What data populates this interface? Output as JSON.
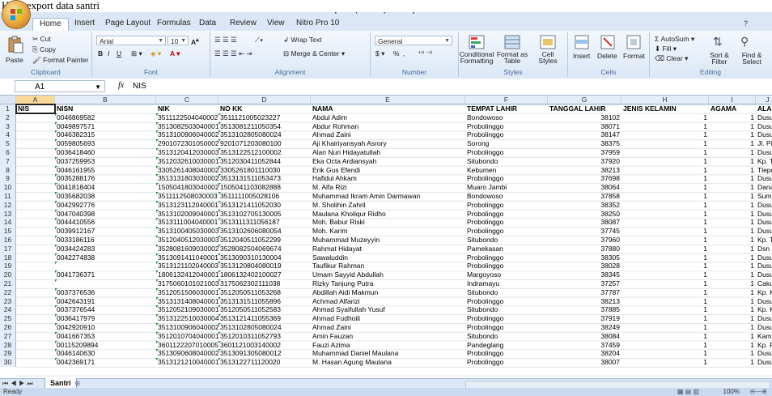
{
  "caption": "Hasil export data santri",
  "window": {
    "title": "Data santri  [Compatibility Mode] - Microsoft Excel",
    "minimize": "–",
    "maximize": "☐",
    "close": "✕"
  },
  "tabs": [
    "Home",
    "Insert",
    "Page Layout",
    "Formulas",
    "Data",
    "Review",
    "View",
    "Nitro Pro 10"
  ],
  "ribbon": {
    "clipboard": {
      "label": "Clipboard",
      "paste": "Paste",
      "cut": "Cut",
      "copy": "Copy",
      "format_painter": "Format Painter"
    },
    "font": {
      "label": "Font",
      "name": "Arial",
      "size": "10",
      "bold": "B",
      "italic": "I",
      "underline": "U"
    },
    "alignment": {
      "label": "Alignment",
      "wrap": "Wrap Text",
      "merge": "Merge & Center"
    },
    "number": {
      "label": "Number",
      "format": "General",
      "percent": "%",
      "comma": ","
    },
    "styles": {
      "label": "Styles",
      "conditional": "Conditional Formatting",
      "format_table": "Format as Table",
      "cell_styles": "Cell Styles"
    },
    "cells": {
      "label": "Cells",
      "insert": "Insert",
      "delete": "Delete",
      "format": "Format"
    },
    "editing": {
      "label": "Editing",
      "autosum": "AutoSum",
      "fill": "Fill",
      "clear": "Clear",
      "sort": "Sort & Filter",
      "find": "Find & Select"
    }
  },
  "formula_bar": {
    "name_box": "A1",
    "fx": "fx",
    "formula": "NIS"
  },
  "columns": [
    "A",
    "B",
    "C",
    "D",
    "E",
    "F",
    "G",
    "H",
    "I",
    "J"
  ],
  "header_row": [
    "NIS",
    "NISN",
    "NIK",
    "NO KK",
    "NAMA",
    "TEMPAT LAHIR",
    "TANGGAL LAHIR",
    "JENIS KELAMIN",
    "AGAMA",
    "ALAMA"
  ],
  "rows": [
    [
      "",
      "0046869582",
      "3511122504040002",
      "3511121005023227",
      "Abdul Adim",
      "Bondowoso",
      "38102",
      "1",
      "1",
      "Dusun"
    ],
    [
      "",
      "0049897571",
      "3513082503040001",
      "3513081211050354",
      "Abdur Rohman",
      "Probolinggo",
      "38071",
      "1",
      "1",
      "Dusun"
    ],
    [
      "",
      "0046382315",
      "3513100906040002",
      "3513102805080024",
      "Ahmad Zaini",
      "Probolinggo",
      "38147",
      "1",
      "1",
      "Dusun"
    ],
    [
      "",
      "0059805693",
      "2901072301050002",
      "9201071203080100",
      "Aji Khairiyansyah Asrory",
      "Sorong",
      "38375",
      "1",
      "1",
      "Jl. Pisa"
    ],
    [
      "",
      "0036418460",
      "3513120412030003",
      "3513122512100002",
      "Alan Nuri Hidayatullah",
      "Probolinggo",
      "37959",
      "1",
      "1",
      "Dusun"
    ],
    [
      "",
      "0037259953",
      "3512032610030001",
      "3512030411052844",
      "Eka Octa Ardiansyah",
      "Situbondo",
      "37920",
      "1",
      "1",
      "Kp. Tar"
    ],
    [
      "",
      "0046161955",
      "3305261408040002",
      "3305261801110030",
      "Erik Gus Efendi",
      "Kebumen",
      "38213",
      "1",
      "1",
      "Tlepok"
    ],
    [
      "",
      "0035288176",
      "3513131803030002",
      "3513131511053473",
      "Hafidul Ahkam",
      "Probolinggo",
      "37698",
      "1",
      "1",
      "Dusun"
    ],
    [
      "",
      "0041818404",
      "1505041803040002",
      "1505041103082888",
      "M. Alfa Rizi",
      "Muaro Jambi",
      "38064",
      "1",
      "1",
      "Danau"
    ],
    [
      "",
      "0035682038",
      "3511112508030003",
      "3511111005028106",
      "Muhammad Ikram Amin Darmawan",
      "Bondowoso",
      "37858",
      "1",
      "1",
      "Sumbe"
    ],
    [
      "",
      "0042992776",
      "3513123112040001",
      "3513121411052030",
      "M. Sholihin Zahril",
      "Probolinggo",
      "38352",
      "1",
      "1",
      "Dusun"
    ],
    [
      "",
      "0047040398",
      "3513102009040001",
      "3513102705130005",
      "Maulana Kholiqur Ridho",
      "Probolinggo",
      "38250",
      "1",
      "1",
      "Dusun"
    ],
    [
      "",
      "0044410556",
      "3513111004040001",
      "3513111311056187",
      "Moh. Babur Riski",
      "Probolinggo",
      "38087",
      "1",
      "1",
      "Dusun"
    ],
    [
      "",
      "0039912167",
      "3513100405030003",
      "3513102606080054",
      "Moh. Karim",
      "Probolinggo",
      "37745",
      "1",
      "1",
      "Dusun"
    ],
    [
      "",
      "0033186116",
      "3512040512030003",
      "3512040511052299",
      "Muhammad Muzeyyin",
      "Situbondo",
      "37960",
      "1",
      "1",
      "Kp. Tre"
    ],
    [
      "",
      "0034424283",
      "3528081609030002",
      "3528082504069674",
      "Rahmat Hidayat",
      "Pamekasan",
      "37880",
      "1",
      "1",
      "Dsn Ka"
    ],
    [
      "",
      "0042274838",
      "3513091411040001",
      "3513090310130004",
      "Sawaluddin",
      "Probolinggo",
      "38305",
      "1",
      "1",
      "Dusun"
    ],
    [
      "",
      "",
      "3513121102040003",
      "3513120804080019",
      "Taufikur Rahman",
      "Probolinggo",
      "38028",
      "1",
      "1",
      "Dusun"
    ],
    [
      "",
      "0041736371",
      "1806132412040001",
      "1806132402100027",
      "Umam Sayyid Abdullah",
      "Margoyoso",
      "38345",
      "1",
      "1",
      "Dusun"
    ],
    [
      "",
      "",
      "3175060101021003",
      "3175062302111038",
      "Rizky Tanjung Putra",
      "Indramayu",
      "37257",
      "1",
      "1",
      "Cakung"
    ],
    [
      "",
      "0037376536",
      "3512051506030001",
      "3512050511053268",
      "Abdillah Aidi Makmun",
      "Situbondo",
      "37787",
      "1",
      "1",
      "Kp. Kra"
    ],
    [
      "",
      "0042643191",
      "3513131408040001",
      "3513131511055896",
      "Achmad Alfarizi",
      "Probolinggo",
      "38213",
      "1",
      "1",
      "Dusun"
    ],
    [
      "",
      "0037376544",
      "3512052109030001",
      "3512050511052583",
      "Ahmad Syaifullah Yusuf",
      "Situbondo",
      "37885",
      "1",
      "1",
      "Kp. Ka"
    ],
    [
      "",
      "0036417979",
      "3513122510030004",
      "3513121411055369",
      "Ahmad Fudhoili",
      "Probolinggo",
      "37919",
      "1",
      "1",
      "Dusun"
    ],
    [
      "",
      "0042920910",
      "3513100906040002",
      "3513102805080024",
      "Ahmad Zaini",
      "Probolinggo",
      "38249",
      "1",
      "1",
      "Dusun"
    ],
    [
      "",
      "0041667353",
      "3512010704040001",
      "3512010311052793",
      "Amin Fauzan",
      "Situbondo",
      "38084",
      "1",
      "1",
      "Kampu"
    ],
    [
      "",
      "00115209894",
      "3601122207010005",
      "3601121003140002",
      "Fauzi Azima",
      "Pandeglang",
      "37459",
      "1",
      "1",
      "Kp. Pa"
    ],
    [
      "",
      "0046140630",
      "3513090608040002",
      "3513091305080012",
      "Muhammad Daniel Maulana",
      "Probolinggo",
      "38204",
      "1",
      "1",
      "Dusun"
    ],
    [
      "",
      "0042369171",
      "3513121210040001",
      "3513122711120020",
      "M. Hasan Agung Maulana",
      "Probolinggo",
      "38007",
      "1",
      "1",
      "Dusun"
    ]
  ],
  "sheet_tab": "Santri",
  "status": {
    "ready": "Ready",
    "zoom": "100%"
  }
}
